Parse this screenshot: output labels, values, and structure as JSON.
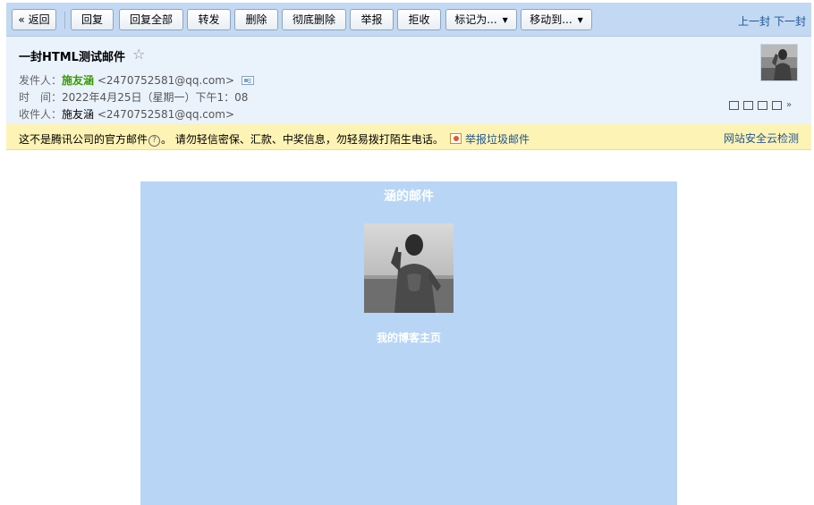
{
  "toolbar": {
    "back_label": "« 返回",
    "reply_label": "回复",
    "reply_all_label": "回复全部",
    "forward_label": "转发",
    "delete_label": "删除",
    "delete_forever_label": "彻底删除",
    "report_label": "举报",
    "reject_label": "拒收",
    "mark_as_label": "标记为...",
    "move_to_label": "移动到...",
    "prev_label": "上一封",
    "next_label": "下一封"
  },
  "header": {
    "subject": "一封HTML测试邮件",
    "from_label": "发件人：",
    "from_name": "施友涵",
    "from_email": "<2470752581@qq.com>",
    "time_label": "时　间：",
    "time_value": "2022年4月25日（星期一）下午1：08",
    "to_label": "收件人：",
    "to_name": "施友涵",
    "to_email": "<2470752581@qq.com>"
  },
  "warning": {
    "text_before": "这不是腾讯公司的官方邮件",
    "help_glyph": "?",
    "text_after": "。 请勿轻信密保、汇款、中奖信息，勿轻易拨打陌生电话。",
    "report_spam": "举报垃圾邮件",
    "security_check": "网站安全云检测"
  },
  "mail": {
    "title": "涵的邮件",
    "blog_link": "我的博客主页"
  },
  "icons": {
    "star": "star-icon",
    "contact_card": "contact-card-icon",
    "help": "help-icon",
    "report": "report-icon"
  },
  "colors": {
    "toolbar_bg": "#c3d9f3",
    "header_bg": "#eaf2fc",
    "warning_bg": "#fdf3b5",
    "mail_bg": "#b8d5f6",
    "link": "#1e5494",
    "sender": "#3a9a00"
  }
}
